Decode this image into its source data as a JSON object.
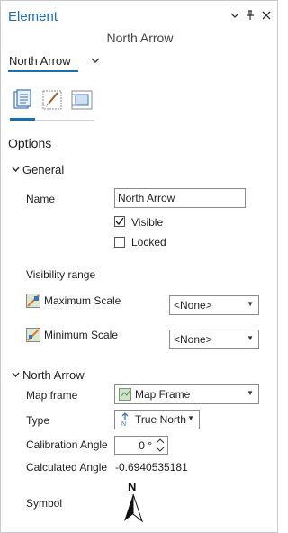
{
  "pane": {
    "title": "Element",
    "controls": {
      "menu": "⌄",
      "pin": "⊥",
      "close": "✕"
    },
    "subtitle": "North Arrow"
  },
  "element_selector": {
    "value": "North Arrow",
    "chevron": "⌄"
  },
  "tabs": [
    {
      "name": "options-tab",
      "icon": "properties-list-icon",
      "selected": true
    },
    {
      "name": "symbol-tab",
      "icon": "brush-icon",
      "selected": false
    },
    {
      "name": "placement-tab",
      "icon": "placement-icon",
      "selected": false
    }
  ],
  "options_heading": "Options",
  "general": {
    "heading": "General",
    "name_label": "Name",
    "name_value": "North Arrow",
    "visible_label": "Visible",
    "visible_checked": true,
    "locked_label": "Locked",
    "locked_checked": false,
    "visibility_range_label": "Visibility range",
    "max_scale_label": "Maximum Scale",
    "max_scale_value": "<None>",
    "min_scale_label": "Minimum Scale",
    "min_scale_value": "<None>"
  },
  "north_arrow": {
    "heading": "North Arrow",
    "map_frame_label": "Map frame",
    "map_frame_value": "Map Frame",
    "type_label": "Type",
    "type_value": "True North",
    "calibration_label": "Calibration Angle",
    "calibration_value": "0 °",
    "calculated_label": "Calculated Angle",
    "calculated_value": "-0.6940535181",
    "symbol_label": "Symbol",
    "symbol_letter": "N"
  },
  "colors": {
    "accent": "#1a6fb3"
  }
}
